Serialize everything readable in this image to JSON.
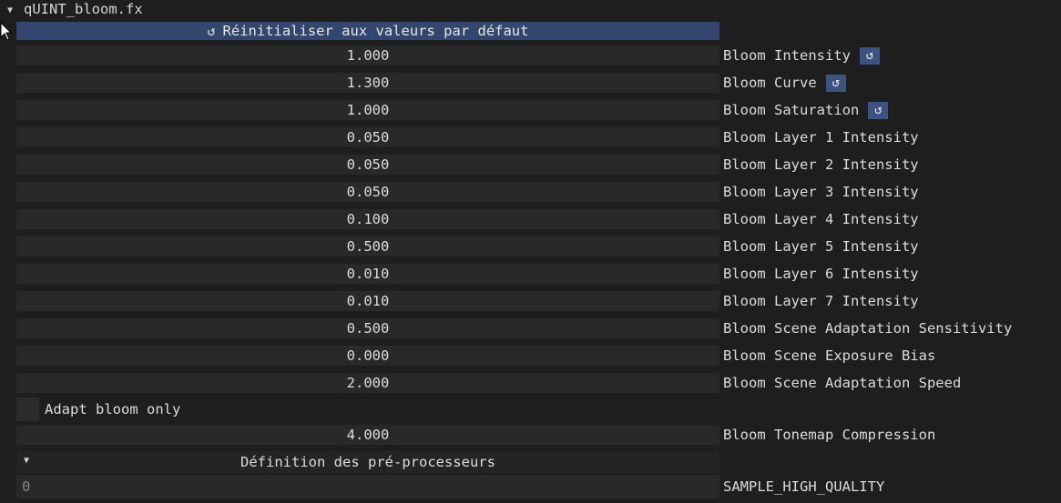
{
  "header": {
    "title": "qUINT_bloom.fx"
  },
  "reset_all_label": "Réinitialiser aux valeurs par défaut",
  "params": [
    {
      "value": "1.000",
      "label": "Bloom Intensity",
      "resettable": true
    },
    {
      "value": "1.300",
      "label": "Bloom Curve",
      "resettable": true
    },
    {
      "value": "1.000",
      "label": "Bloom Saturation",
      "resettable": true
    },
    {
      "value": "0.050",
      "label": "Bloom Layer 1 Intensity",
      "resettable": false
    },
    {
      "value": "0.050",
      "label": "Bloom Layer 2 Intensity",
      "resettable": false
    },
    {
      "value": "0.050",
      "label": "Bloom Layer 3 Intensity",
      "resettable": false
    },
    {
      "value": "0.100",
      "label": "Bloom Layer 4 Intensity",
      "resettable": false
    },
    {
      "value": "0.500",
      "label": "Bloom Layer 5 Intensity",
      "resettable": false
    },
    {
      "value": "0.010",
      "label": "Bloom Layer 6 Intensity",
      "resettable": false
    },
    {
      "value": "0.010",
      "label": "Bloom Layer 7 Intensity",
      "resettable": false
    },
    {
      "value": "0.500",
      "label": "Bloom Scene Adaptation Sensitivity",
      "resettable": false
    },
    {
      "value": "0.000",
      "label": "Bloom Scene Exposure Bias",
      "resettable": false
    },
    {
      "value": "2.000",
      "label": "Bloom Scene Adaptation Speed",
      "resettable": false
    }
  ],
  "checkbox": {
    "label": "Adapt bloom only",
    "checked": false
  },
  "tonemap": {
    "value": "4.000",
    "label": "Bloom Tonemap Compression"
  },
  "preprocessor": {
    "title": "Définition des pré-processeurs",
    "define_value": "0",
    "define_name": "SAMPLE_HIGH_QUALITY"
  },
  "icons": {
    "collapse": "triangle-down-icon",
    "reset": "reset-icon",
    "cursor": "mouse-cursor-icon"
  },
  "colors": {
    "background": "#1e1e1e",
    "frame": "#292929",
    "reset_all_bg": "#33476e",
    "reset_button_bg": "#3c5282",
    "text": "#dcdcdc"
  }
}
